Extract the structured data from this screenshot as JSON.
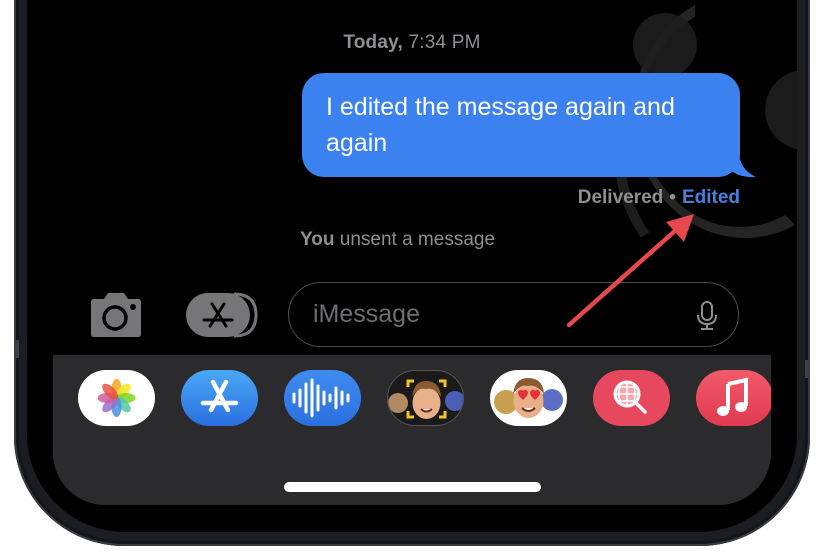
{
  "conversation": {
    "timestamp_day": "Today,",
    "timestamp_time": "7:34 PM",
    "message": {
      "text": "I edited the message again and again",
      "sender": "me",
      "bubble_color": "#3b82f0"
    },
    "receipt": {
      "status": "Delivered",
      "separator": "•",
      "edited_label": "Edited",
      "edited_color": "#4a7fe0"
    },
    "unsent_notice": {
      "subject": "You",
      "text": "unsent a message"
    }
  },
  "compose": {
    "camera_icon": "camera-icon",
    "apps_icon": "app-store-icon",
    "placeholder": "iMessage",
    "value": "",
    "mic_icon": "microphone-icon"
  },
  "app_drawer": {
    "apps": [
      {
        "name": "Photos",
        "icon": "photos-icon"
      },
      {
        "name": "App Store",
        "icon": "app-store-icon"
      },
      {
        "name": "Audio Message",
        "icon": "audio-waveform-icon"
      },
      {
        "name": "Memoji",
        "icon": "memoji-icon"
      },
      {
        "name": "Memoji Stickers",
        "icon": "memoji-stickers-icon"
      },
      {
        "name": "Images Search",
        "icon": "globe-search-icon"
      },
      {
        "name": "Music",
        "icon": "music-note-icon"
      }
    ]
  },
  "annotation": {
    "arrow_color": "#e5484d",
    "points_to": "Edited"
  }
}
